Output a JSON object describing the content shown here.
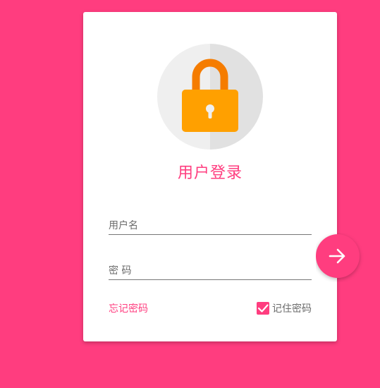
{
  "login": {
    "title": "用户登录",
    "username_placeholder": "用户名",
    "password_placeholder": "密 码",
    "forgot_label": "忘记密码",
    "remember_label": "记住密码",
    "remember_checked": true
  },
  "icons": {
    "lock": "lock-icon",
    "submit": "arrow-right-icon",
    "check": "check-icon"
  },
  "colors": {
    "background": "#ff3d7f",
    "accent": "#ff3d7f",
    "lock_body": "#ffa000",
    "lock_shackle": "#f57c00",
    "avatar_light": "#efefef",
    "avatar_dark": "#e1e1e1"
  }
}
